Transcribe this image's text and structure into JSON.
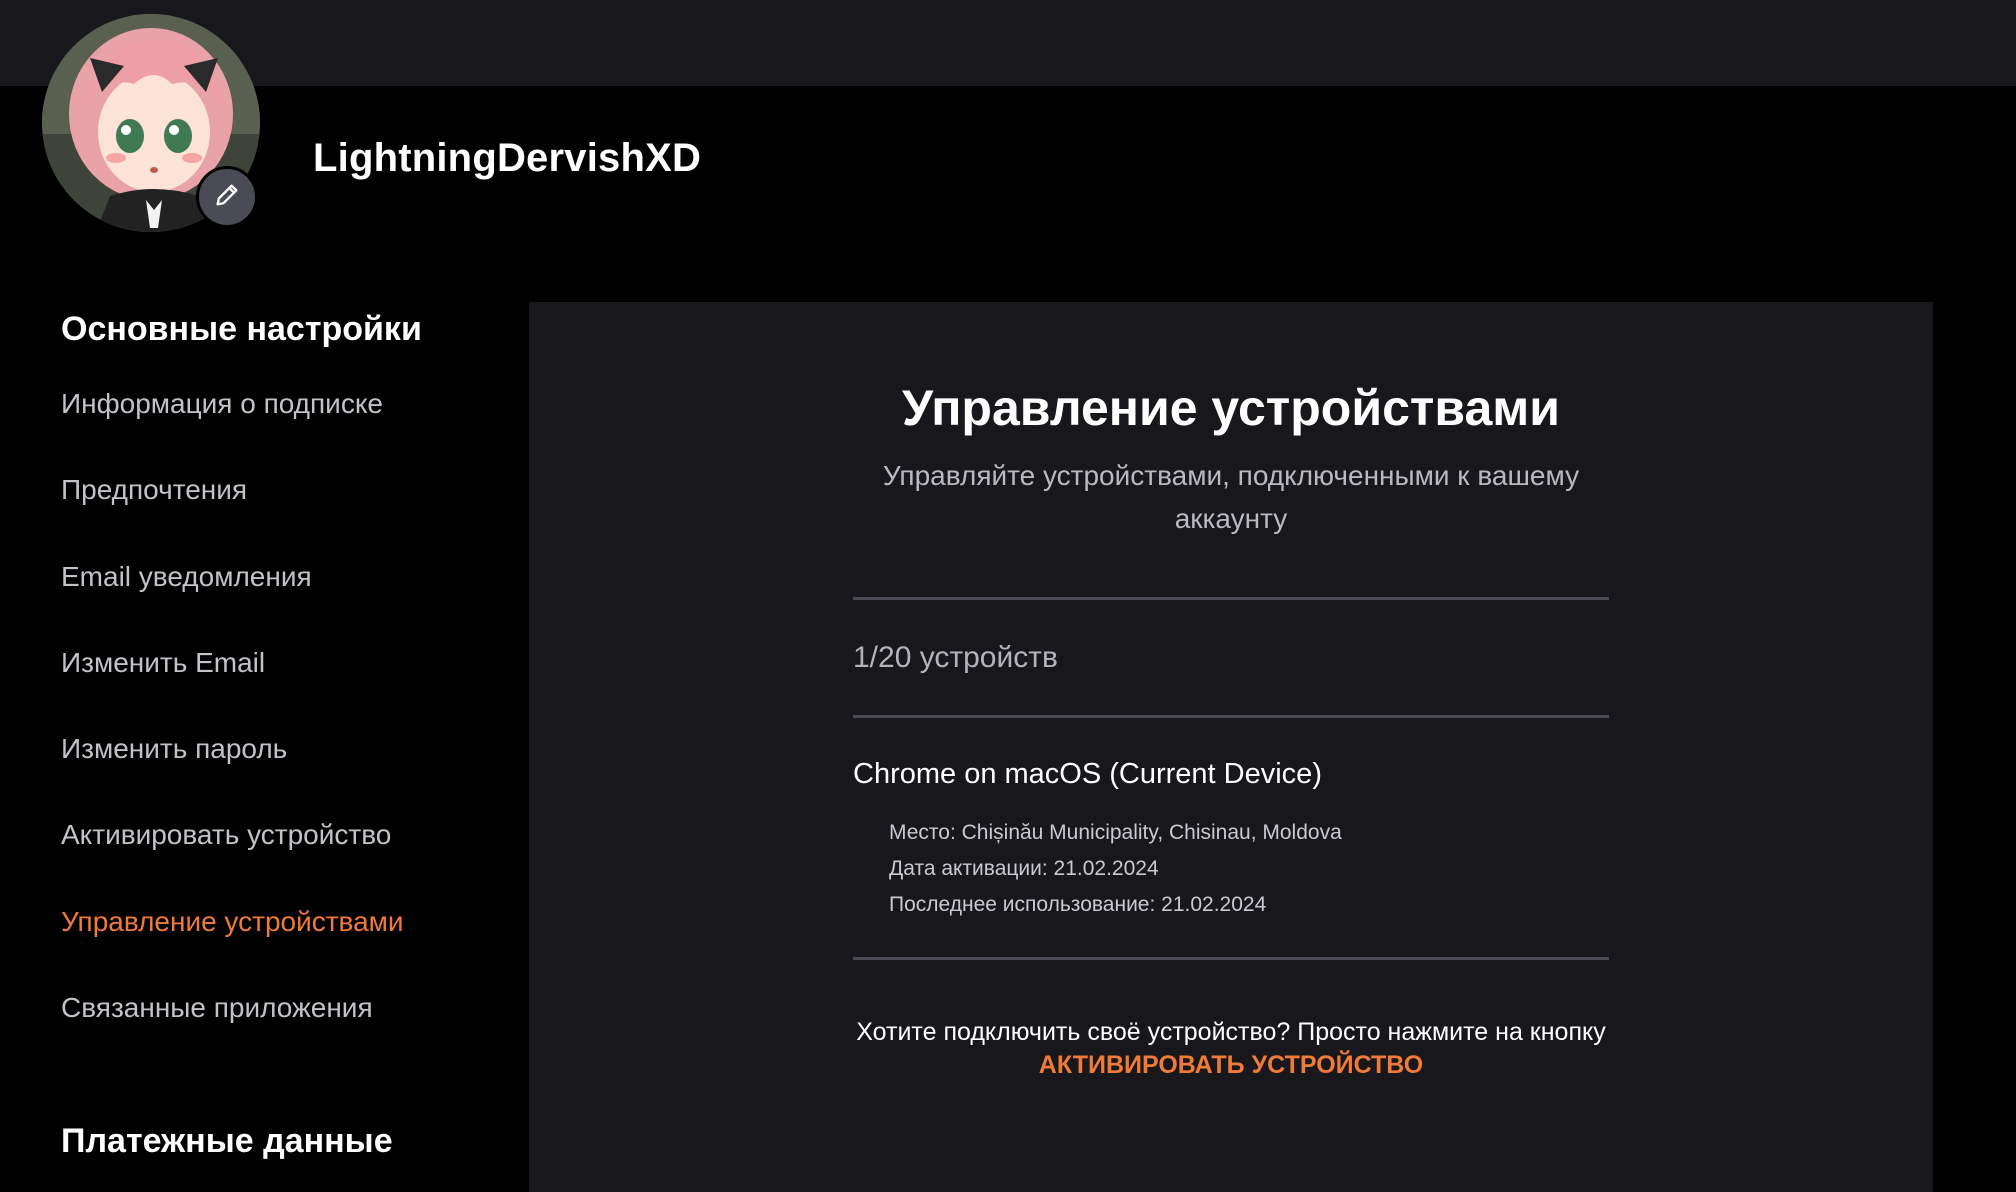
{
  "header": {
    "username": "LightningDervishXD"
  },
  "sidebar": {
    "heading": "Основные настройки",
    "items": [
      {
        "label": "Информация о подписке"
      },
      {
        "label": "Предпочтения"
      },
      {
        "label": "Email уведомления"
      },
      {
        "label": "Изменить Email"
      },
      {
        "label": "Изменить пароль"
      },
      {
        "label": "Активировать устройство"
      },
      {
        "label": "Управление устройствами",
        "active": true
      },
      {
        "label": "Связанные приложения"
      }
    ],
    "heading2": "Платежные данные"
  },
  "main": {
    "title": "Управление устройствами",
    "subtitle": "Управляйте устройствами, подключенными к вашему аккаунту",
    "device_count": "1/20 устройств",
    "device": {
      "name": "Chrome on macOS (Current Device)",
      "location": "Место: Chișinău Municipality, Chisinau, Moldova",
      "activated": "Дата активации: 21.02.2024",
      "last_used": "Последнее использование: 21.02.2024"
    },
    "footer_text": "Хотите подключить своё устройство? Просто нажмите на кнопку ",
    "footer_link": "АКТИВИРОВАТЬ УСТРОЙСТВО"
  },
  "colors": {
    "accent": "#f07a37",
    "panel_bg": "#18181c",
    "page_bg": "#000000"
  },
  "icons": {
    "edit": "pencil-icon"
  }
}
